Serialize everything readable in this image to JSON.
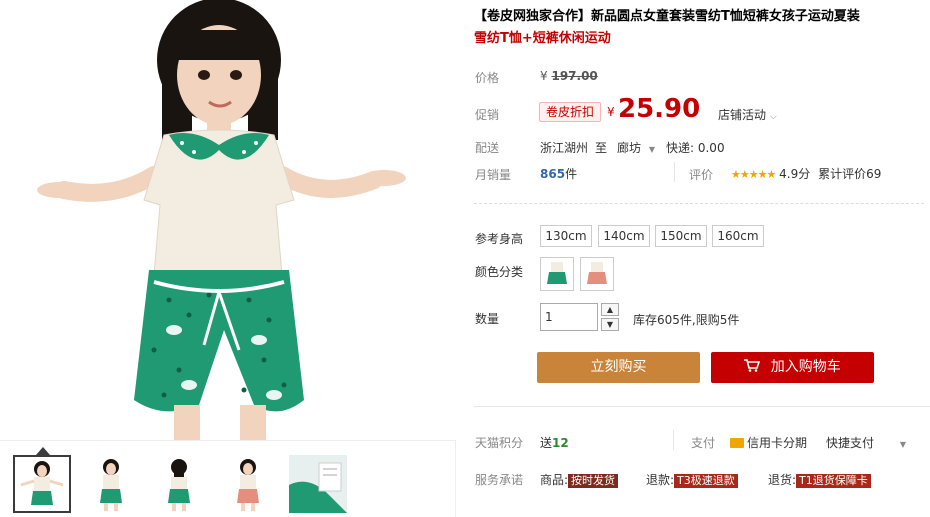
{
  "product": {
    "title": "【卷皮网独家合作】新品圆点女童套装雪纺T恤短裤女孩子运动夏装",
    "subtitle": "雪纺T恤+短裤休闲运动"
  },
  "price": {
    "label": "价格",
    "currency": "¥",
    "original": "197.00"
  },
  "promo": {
    "label": "促销",
    "tag": "卷皮折扣",
    "currency": "¥",
    "price": "25.90",
    "shop_activity": "店铺活动"
  },
  "shipping": {
    "label": "配送",
    "from": "浙江湖州",
    "to_word": "至",
    "to": "廊坊",
    "express": "快递: 0.00"
  },
  "sales": {
    "label": "月销量",
    "count": "865",
    "unit": "件",
    "rating_label": "评价",
    "stars": "★★★★★",
    "score": "4.9分",
    "total_reviews": "累计评价69"
  },
  "size": {
    "label": "参考身高",
    "options": [
      "130cm",
      "140cm",
      "150cm",
      "160cm"
    ]
  },
  "color": {
    "label": "颜色分类"
  },
  "quantity": {
    "label": "数量",
    "value": "1",
    "stock": "库存605件,限购5件"
  },
  "actions": {
    "buy": "立刻购买",
    "cart": "加入购物车"
  },
  "points": {
    "label": "天猫积分",
    "give": "送",
    "amount": "12",
    "pay_label": "支付",
    "credit": "信用卡分期",
    "quick_pay": "快捷支付"
  },
  "service": {
    "label": "服务承诺",
    "goods_label": "商品:",
    "goods_tag": "按时发货",
    "refund_label": "退款:",
    "refund_tag": "T3极速退款",
    "return_label": "退货:",
    "return_tag": "T1退货保障卡"
  },
  "colors": {
    "accent_red": "#c40000",
    "buy_orange": "#c9843a",
    "teal_skirt": "#1f9a73"
  }
}
